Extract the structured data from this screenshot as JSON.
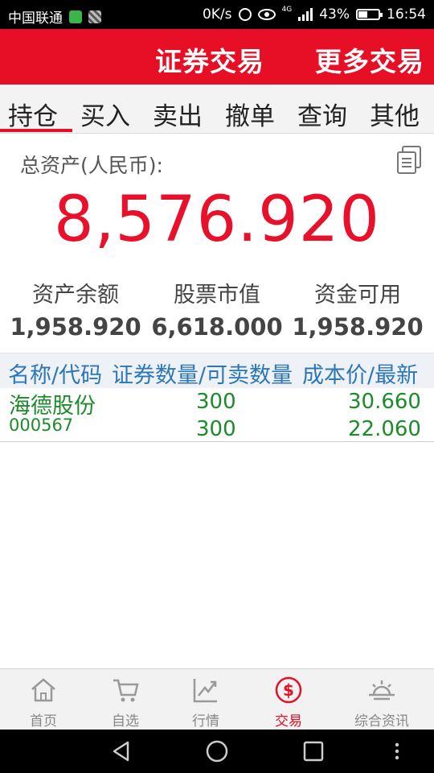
{
  "status_bar": {
    "carrier": "中国联通",
    "speed": "0K/s",
    "network": "4G",
    "battery": "43%",
    "time": "16:54"
  },
  "header": {
    "tabs": [
      "证券交易",
      "更多交易"
    ]
  },
  "subtabs": [
    "持仓",
    "买入",
    "卖出",
    "撤单",
    "查询",
    "其他"
  ],
  "assets": {
    "label": "总资产(人民币):",
    "total": "8,576.920",
    "stats": [
      {
        "label": "资产余额",
        "value": "1,958.920"
      },
      {
        "label": "股票市值",
        "value": "6,618.000"
      },
      {
        "label": "资金可用",
        "value": "1,958.920"
      }
    ]
  },
  "table": {
    "headers": [
      "名称/代码",
      "证券数量/可卖数量",
      "成本价/最新"
    ],
    "rows": [
      {
        "name": "海德股份",
        "code": "000567",
        "qty": "300",
        "sellable": "300",
        "cost": "30.660",
        "latest": "22.060"
      }
    ]
  },
  "bottom_nav": [
    {
      "label": "首页",
      "icon": "home-icon"
    },
    {
      "label": "自选",
      "icon": "cart-icon"
    },
    {
      "label": "行情",
      "icon": "chart-icon"
    },
    {
      "label": "交易",
      "icon": "dollar-icon"
    },
    {
      "label": "综合资讯",
      "icon": "sunrise-icon"
    }
  ],
  "colors": {
    "brand_red": "#e60f25",
    "gain_green": "#1c8b2a",
    "header_blue": "#2d77b8"
  }
}
